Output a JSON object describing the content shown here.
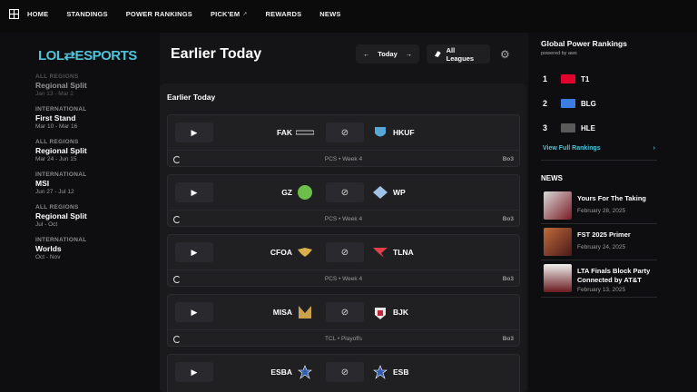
{
  "nav": {
    "items": [
      "HOME",
      "STANDINGS",
      "POWER RANKINGS",
      "PICK'EM",
      "REWARDS",
      "NEWS"
    ],
    "pickem_external": "↗"
  },
  "sidebar": {
    "brand": "LOL⇄ESPORTS",
    "events": [
      {
        "region": "ALL REGIONS",
        "name": "Regional Split",
        "dates": "Jan 13 - Mar 2",
        "dim": true
      },
      {
        "region": "INTERNATIONAL",
        "name": "First Stand",
        "dates": "Mar 10 - Mar 16",
        "dim": false
      },
      {
        "region": "ALL REGIONS",
        "name": "Regional Split",
        "dates": "Mar 24 - Jun 15",
        "dim": false
      },
      {
        "region": "INTERNATIONAL",
        "name": "MSI",
        "dates": "Jun 27 - Jul 12",
        "dim": false
      },
      {
        "region": "ALL REGIONS",
        "name": "Regional Split",
        "dates": "Jul - Oct",
        "dim": false
      },
      {
        "region": "INTERNATIONAL",
        "name": "Worlds",
        "dates": "Oct - Nov",
        "dim": false
      }
    ]
  },
  "main": {
    "title": "Earlier Today",
    "today_label": "Today",
    "leagues_label": "All Leagues",
    "panel_title": "Earlier Today"
  },
  "matches": [
    {
      "team1": "FAK",
      "team2": "HKUF",
      "league": "PCS • Week 4",
      "bo": "Bo3",
      "c1": "#ffffff",
      "c2": "#58a6d6"
    },
    {
      "team1": "GZ",
      "team2": "WP",
      "league": "PCS • Week 4",
      "bo": "Bo3",
      "c1": "#6cc04a",
      "c2": "#9ec3e6"
    },
    {
      "team1": "CFOA",
      "team2": "TLNA",
      "league": "PCS • Week 4",
      "bo": "Bo3",
      "c1": "#d9b04a",
      "c2": "#e0404a"
    },
    {
      "team1": "MISA",
      "team2": "BJK",
      "league": "TCL • Playoffs",
      "bo": "Bo3",
      "c1": "#c9a14a",
      "c2": "#e6e6e6"
    },
    {
      "team1": "ESBA",
      "team2": "ESB",
      "league": "",
      "bo": "",
      "c1": "#2f5db0",
      "c2": "#2f5db0"
    }
  ],
  "rankings": {
    "title": "Global Power Rankings",
    "powered": "powered by aws",
    "items": [
      {
        "rank": "1",
        "team": "T1",
        "color": "#e2012d"
      },
      {
        "rank": "2",
        "team": "BLG",
        "color": "#3b7de0"
      },
      {
        "rank": "3",
        "team": "HLE",
        "color": "#c8c8c8"
      }
    ],
    "full_label": "View Full Rankings",
    "chevron": "›"
  },
  "news": {
    "heading": "NEWS",
    "items": [
      {
        "title": "Yours For The Taking",
        "date": "February 28, 2025",
        "color": "#7a1c25"
      },
      {
        "title": "FST 2025 Primer",
        "date": "February 24, 2025",
        "color": "#7a3a22"
      },
      {
        "title": "LTA Finals Block Party Connected by AT&T",
        "date": "February 13, 2025",
        "color": "#6a1a1e"
      }
    ]
  }
}
